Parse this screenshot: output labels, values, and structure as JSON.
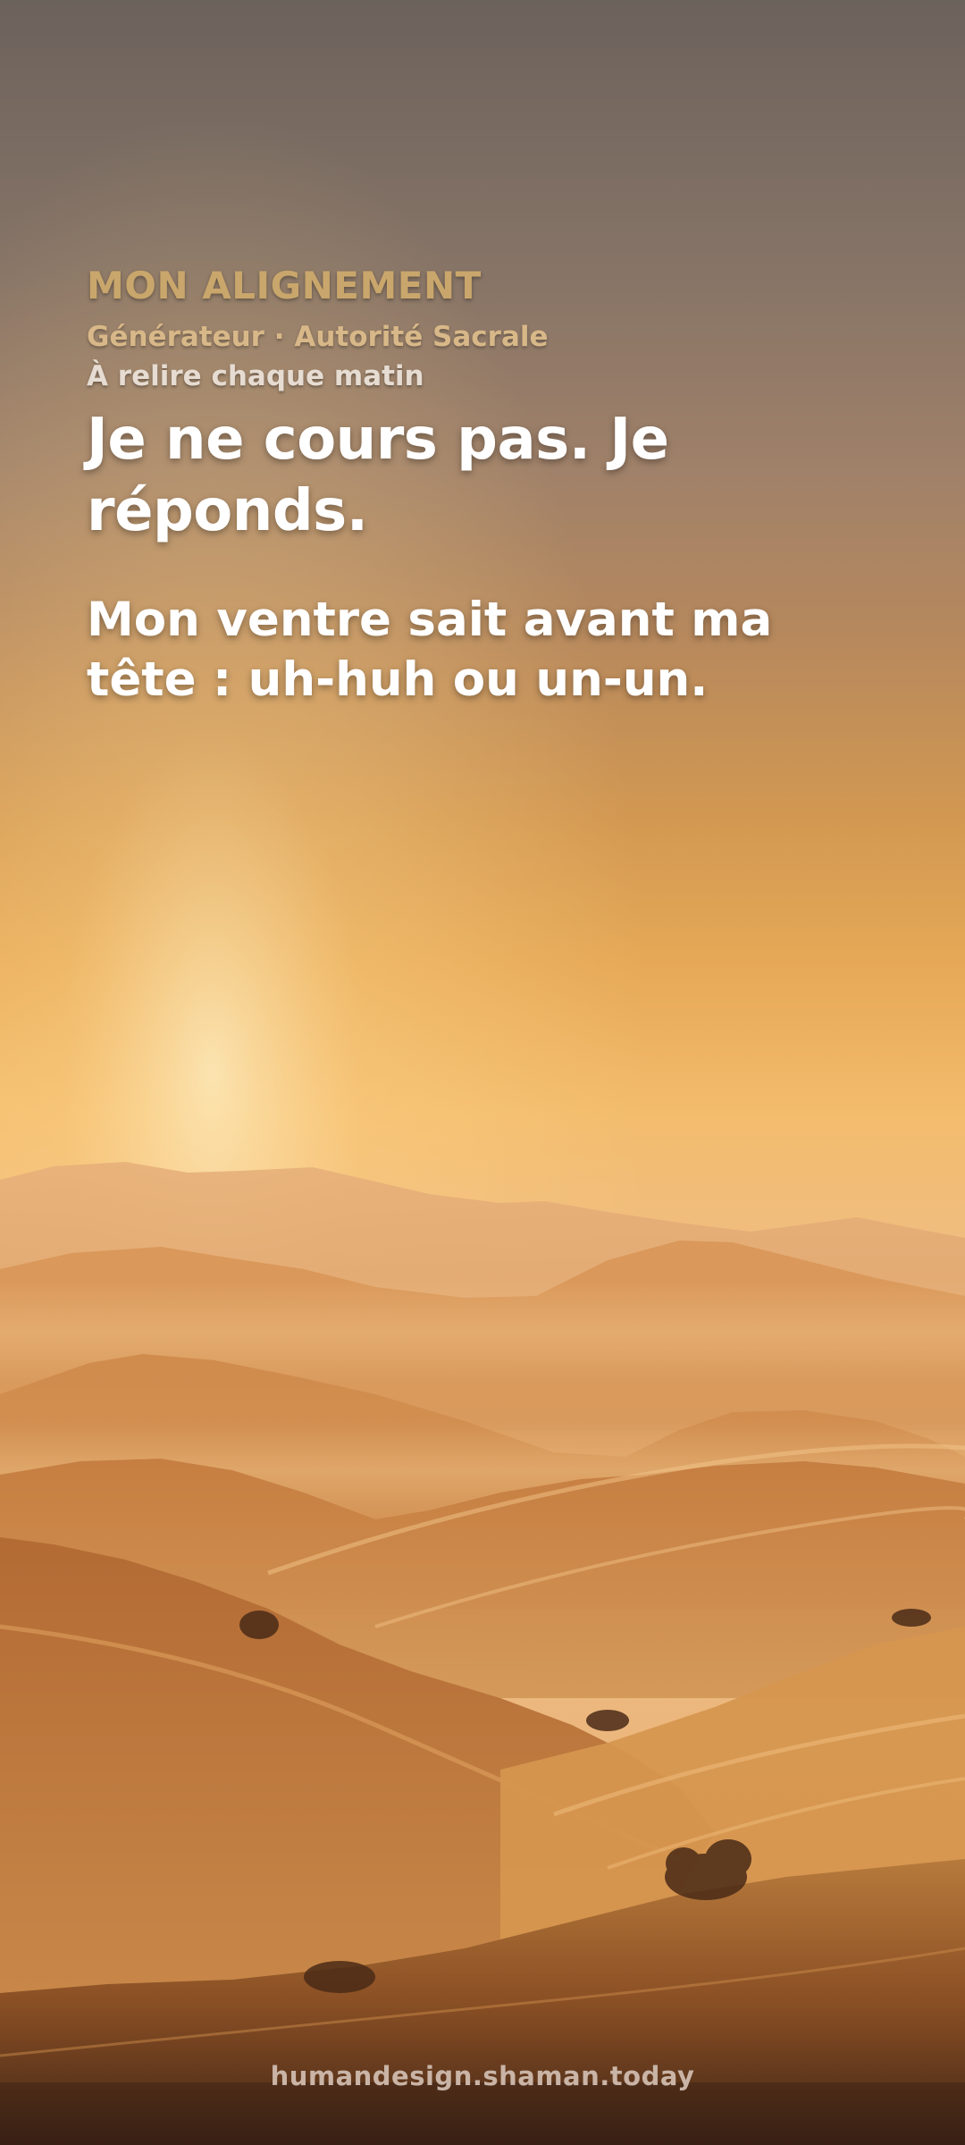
{
  "header": {
    "eyebrow": "MON ALIGNEMENT",
    "subtitle": "Générateur · Autorité Sacrale",
    "note": "À relire chaque matin"
  },
  "main": {
    "headline": "Je ne cours pas. Je réponds.",
    "body": "Mon ventre sait avant ma tête : uh-huh ou un-un."
  },
  "footer": {
    "site": "humandesign.shaman.today"
  },
  "colors": {
    "eyebrow": "#c9a66b",
    "subtitle": "#d8b888",
    "note": "#e6dcd2",
    "text": "#ffffff",
    "footer": "#c9b4a6"
  },
  "background": {
    "scene": "golden sunrise over rolling hills"
  }
}
